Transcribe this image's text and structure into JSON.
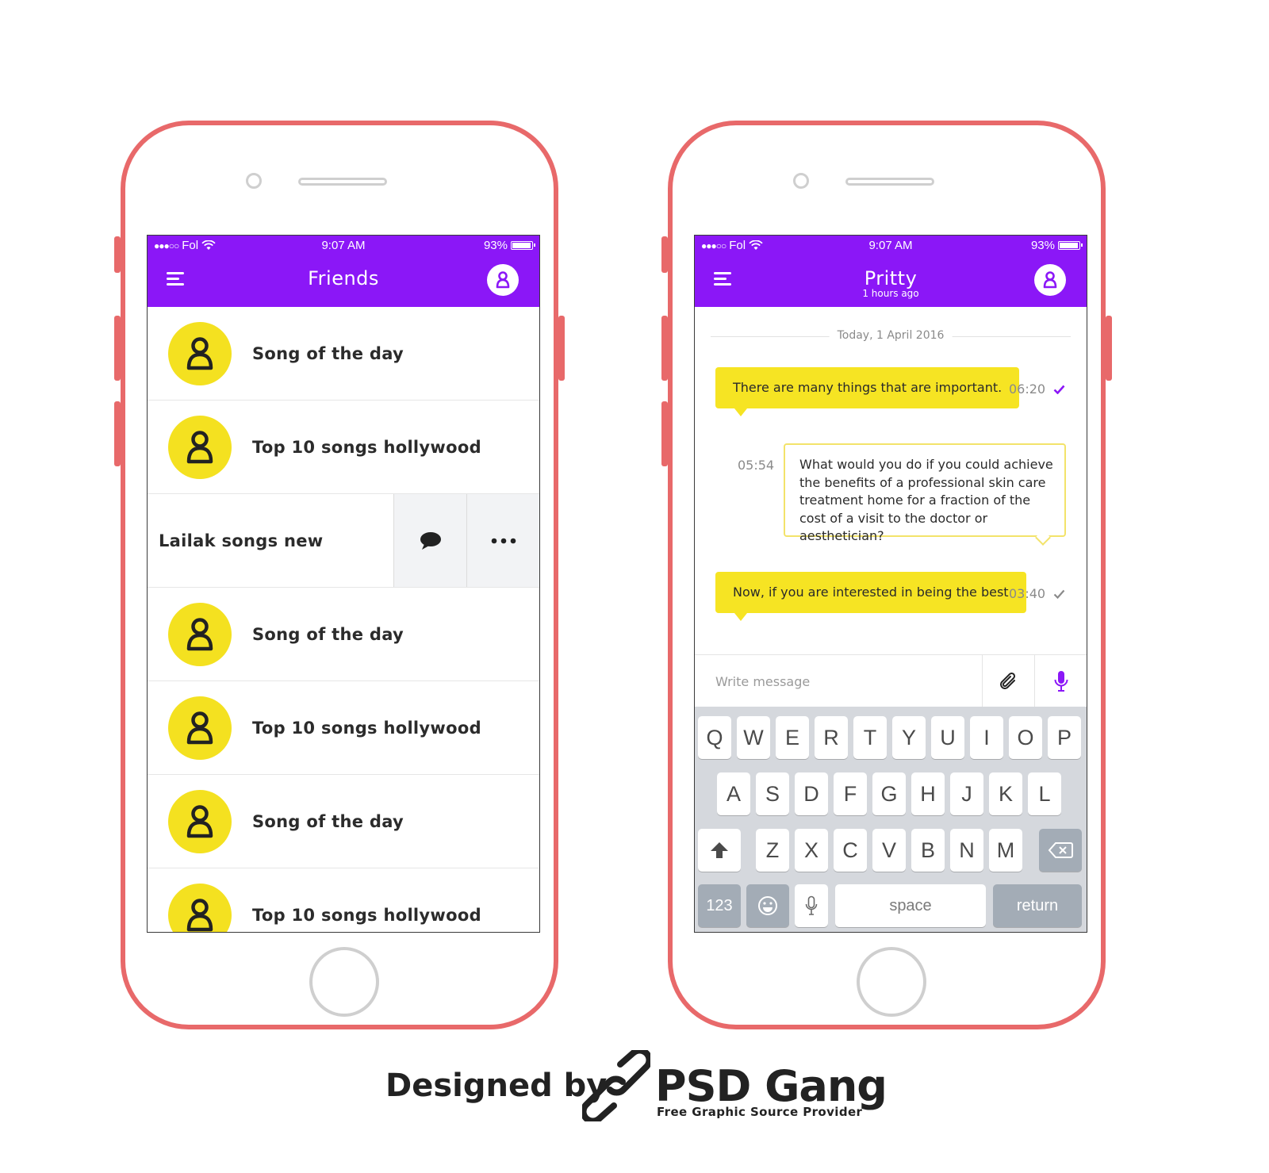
{
  "status_bar": {
    "signal": "●●●○○",
    "carrier": "Fol",
    "time": "9:07 AM",
    "battery": "93%"
  },
  "friends_screen": {
    "title": "Friends",
    "items": [
      {
        "label": "Song of the day"
      },
      {
        "label": "Top 10 songs hollywood"
      },
      {
        "label": "Lailak songs new",
        "swiped": true,
        "actions": [
          "chat-bubble-icon",
          "more-dots-icon"
        ]
      },
      {
        "label": "Song of the day"
      },
      {
        "label": "Top 10 songs hollywood"
      },
      {
        "label": "Song of the day"
      },
      {
        "label": "Top 10 songs hollywood"
      }
    ]
  },
  "chat_screen": {
    "contact_name": "Pritty",
    "last_seen": "1 hours ago",
    "date_divider": "Today, 1 April 2016",
    "messages": [
      {
        "text": "There are many things that are important.",
        "time": "06:20",
        "direction": "outgoing",
        "read": true
      },
      {
        "text": "What would you do if you could achieve the benefits of a professional skin care treatment  home for a fraction of the cost of a visit to the doctor or aesthetician?",
        "time": "05:54",
        "direction": "incoming"
      },
      {
        "text": "Now, if you are interested in being the best",
        "time": "03:40",
        "direction": "outgoing",
        "read": false
      }
    ],
    "compose_placeholder": "Write message",
    "attach_icon": "paperclip-icon",
    "mic_icon": "microphone-icon"
  },
  "keyboard": {
    "row1": [
      "Q",
      "W",
      "E",
      "R",
      "T",
      "Y",
      "U",
      "I",
      "O",
      "P"
    ],
    "row2": [
      "A",
      "S",
      "D",
      "F",
      "G",
      "H",
      "J",
      "K",
      "L"
    ],
    "row3": [
      "Z",
      "X",
      "C",
      "V",
      "B",
      "N",
      "M"
    ],
    "numbers_key": "123",
    "space_key": "space",
    "return_key": "return"
  },
  "footer": {
    "designed_by": "Designed by",
    "brand": "PSD Gang",
    "tagline": "Free Graphic Source Provider"
  },
  "colors": {
    "primary_purple": "#8b17f7",
    "accent_yellow": "#f6e423",
    "frame_coral": "#e8696a",
    "read_check": "#8b17f7",
    "unread_check": "#8a8a8a"
  }
}
